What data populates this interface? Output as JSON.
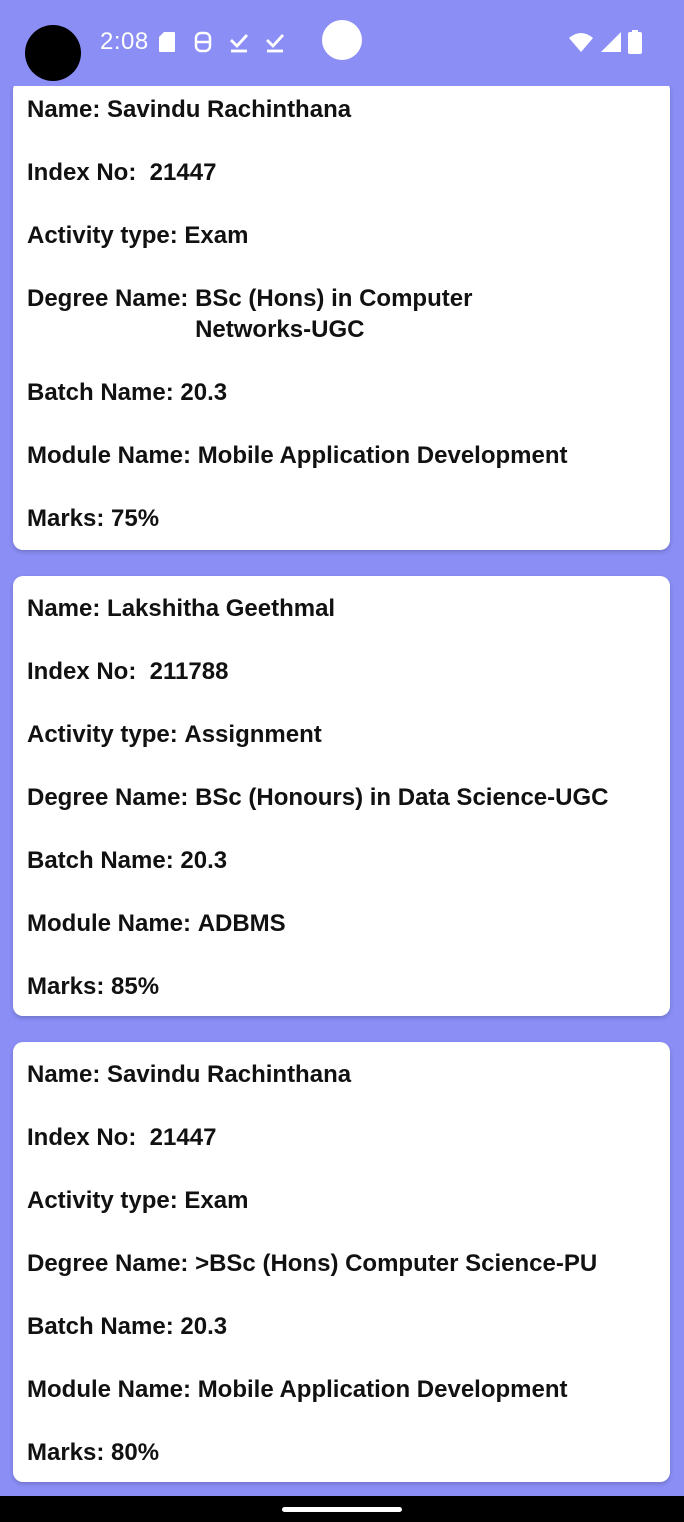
{
  "status_bar": {
    "time": "2:08",
    "left_icons": [
      "sd-card-icon",
      "accessibility-icon",
      "download-done-icon",
      "download-done-icon"
    ],
    "right_icons": [
      "wifi-icon",
      "cell-signal-icon",
      "battery-icon"
    ]
  },
  "cards": [
    {
      "name_label": "Name: ",
      "name": "Savindu Rachinthana",
      "index_label": "Index No:  ",
      "index": "21447",
      "activity_label": "Activity type: ",
      "activity": "Exam",
      "degree_label": "Degree Name: ",
      "degree": "BSc (Hons) in Computer Networks-UGC",
      "batch_label": "Batch Name: ",
      "batch": "20.3",
      "module_label": "Module Name: ",
      "module": "Mobile Application Development",
      "marks_label": "Marks: ",
      "marks": "75%"
    },
    {
      "name_label": "Name: ",
      "name": "Lakshitha Geethmal",
      "index_label": "Index No:  ",
      "index": "211788",
      "activity_label": "Activity type: ",
      "activity": "Assignment",
      "degree_label": "Degree Name: ",
      "degree": "BSc (Honours) in Data Science-UGC",
      "batch_label": "Batch Name: ",
      "batch": "20.3",
      "module_label": "Module Name: ",
      "module": "ADBMS",
      "marks_label": "Marks: ",
      "marks": "85%"
    },
    {
      "name_label": "Name: ",
      "name": "Savindu Rachinthana",
      "index_label": "Index No:  ",
      "index": "21447",
      "activity_label": "Activity type: ",
      "activity": "Exam",
      "degree_label": "Degree Name: ",
      "degree": ">BSc (Hons) Computer Science-PU",
      "batch_label": "Batch Name: ",
      "batch": "20.3",
      "module_label": "Module Name: ",
      "module": "Mobile Application Development",
      "marks_label": "Marks: ",
      "marks": "80%"
    }
  ],
  "colors": {
    "background": "#8a8ef5",
    "card": "#ffffff",
    "text": "#111111",
    "nav_bar": "#000000"
  }
}
